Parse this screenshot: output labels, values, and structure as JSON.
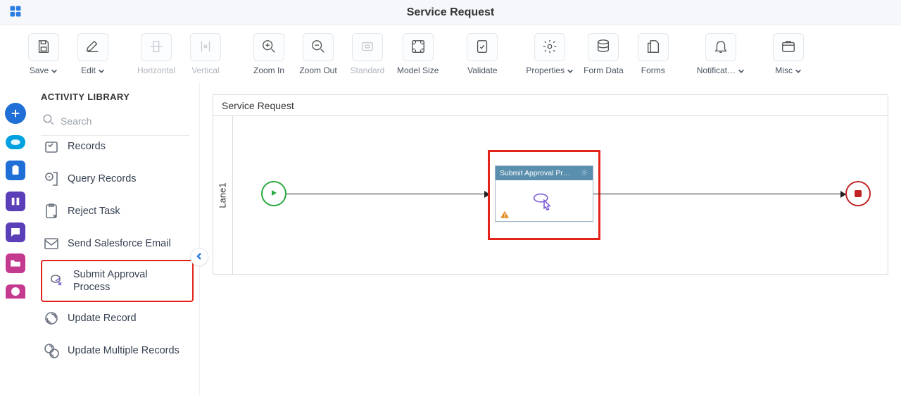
{
  "title": "Service Request",
  "toolbar": [
    {
      "id": "save",
      "label": "Save",
      "chevron": true,
      "disabled": false
    },
    {
      "id": "edit",
      "label": "Edit",
      "chevron": true,
      "disabled": false
    },
    {
      "id": "horizontal",
      "label": "Horizontal",
      "chevron": false,
      "disabled": true
    },
    {
      "id": "vertical",
      "label": "Vertical",
      "chevron": false,
      "disabled": true
    },
    {
      "id": "zoom-in",
      "label": "Zoom In",
      "chevron": false,
      "disabled": false
    },
    {
      "id": "zoom-out",
      "label": "Zoom Out",
      "chevron": false,
      "disabled": false
    },
    {
      "id": "standard",
      "label": "Standard",
      "chevron": false,
      "disabled": true
    },
    {
      "id": "model-size",
      "label": "Model Size",
      "chevron": false,
      "disabled": false
    },
    {
      "id": "validate",
      "label": "Validate",
      "chevron": false,
      "disabled": false
    },
    {
      "id": "properties",
      "label": "Properties",
      "chevron": true,
      "disabled": false
    },
    {
      "id": "form-data",
      "label": "Form Data",
      "chevron": false,
      "disabled": false
    },
    {
      "id": "forms",
      "label": "Forms",
      "chevron": false,
      "disabled": false
    },
    {
      "id": "notifications",
      "label": "Notificat…",
      "chevron": true,
      "disabled": false
    },
    {
      "id": "misc",
      "label": "Misc",
      "chevron": true,
      "disabled": false
    }
  ],
  "library": {
    "title": "ACTIVITY LIBRARY",
    "search_placeholder": "Search",
    "items": [
      {
        "label": "Records",
        "truncated_top": true
      },
      {
        "label": "Query Records"
      },
      {
        "label": "Reject Task"
      },
      {
        "label": "Send Salesforce Email"
      },
      {
        "label": "Submit Approval Process",
        "highlighted": true
      },
      {
        "label": "Update Record"
      },
      {
        "label": "Update Multiple Records"
      }
    ]
  },
  "canvas": {
    "header": "Service Request",
    "lane_label": "Lane1",
    "task_title": "Submit Approval Proc..."
  }
}
